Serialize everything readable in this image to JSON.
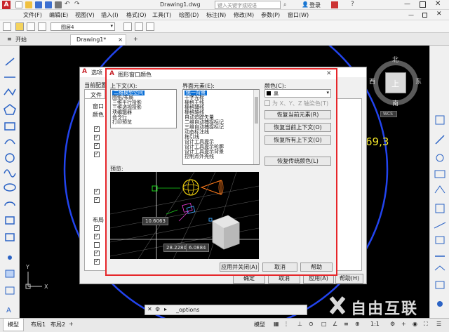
{
  "titlebar": {
    "document": "Drawing1.dwg",
    "search_placeholder": "键入关键字或短语",
    "login": "登录"
  },
  "menubar": {
    "items": [
      "文件(F)",
      "编辑(E)",
      "视图(V)",
      "插入(I)",
      "格式(O)",
      "工具(T)",
      "绘图(D)",
      "标注(N)",
      "修改(M)",
      "参数(P)",
      "窗口(W)"
    ]
  },
  "ribbon": {
    "layer_name": "图层4"
  },
  "doctabs": {
    "start": "开始",
    "drawing": "Drawing1*",
    "close": "×",
    "add": "+"
  },
  "viewcube": {
    "top": "上",
    "north": "北",
    "south": "南",
    "east": "东",
    "west": "西",
    "wcs": "WCS"
  },
  "canvas": {
    "dim_text": "69,3"
  },
  "options_dialog": {
    "title": "选项",
    "current_config": "当前配置",
    "tab_file": "文件",
    "window_elements": "窗口",
    "color_label": "颜色",
    "layout_elements": "布局",
    "ok": "确定",
    "cancel": "取消",
    "apply": "应用(A)",
    "help": "帮助(H)"
  },
  "color_dialog": {
    "title": "图形窗口颜色",
    "context_label": "上下文(X):",
    "context_items": [
      "二维模型空间",
      "图纸/布局",
      "三维平行投影",
      "三维透视投影",
      "块编辑器",
      "命令行",
      "打印预览"
    ],
    "interface_label": "界面元素(E):",
    "interface_items": [
      "统一背景",
      "十字光标",
      "栅格主线",
      "栅格辅线",
      "栅格轴线",
      "自动追踪矢量",
      "二维自动捕捉标记",
      "三维自动捕捉标记",
      "动态标注线",
      "拖引线",
      "设计工具提示",
      "设计工具提示轮廓",
      "设计工具提示背景",
      "控制点外壳线"
    ],
    "color_label": "颜色(C):",
    "color_value": "黑",
    "tint_label": "为 X、Y、Z 轴染色(T)",
    "restore_current_element": "恢复当前元素(R)",
    "restore_current_context": "恢复当前上下文(O)",
    "restore_all_contexts": "恢复所有上下文(O)",
    "restore_classic": "恢复传统颜色(L)",
    "preview_label": "预览:",
    "tip1": "10.6063",
    "tip2": "28.2280",
    "tip3": "6.0884",
    "apply_close": "应用并关闭(A)",
    "cancel": "取消",
    "help": "帮助"
  },
  "command": {
    "value": "_options"
  },
  "statusbar": {
    "model_tab": "模型",
    "layout1": "布局1",
    "layout2": "布局2",
    "model_btn": "模型",
    "scale": "1:1"
  },
  "watermark": {
    "text": "自由互联"
  },
  "colors": {
    "accent_red": "#e6262a",
    "selection_blue": "#0a6fd6",
    "canvas_bg": "#000000"
  }
}
